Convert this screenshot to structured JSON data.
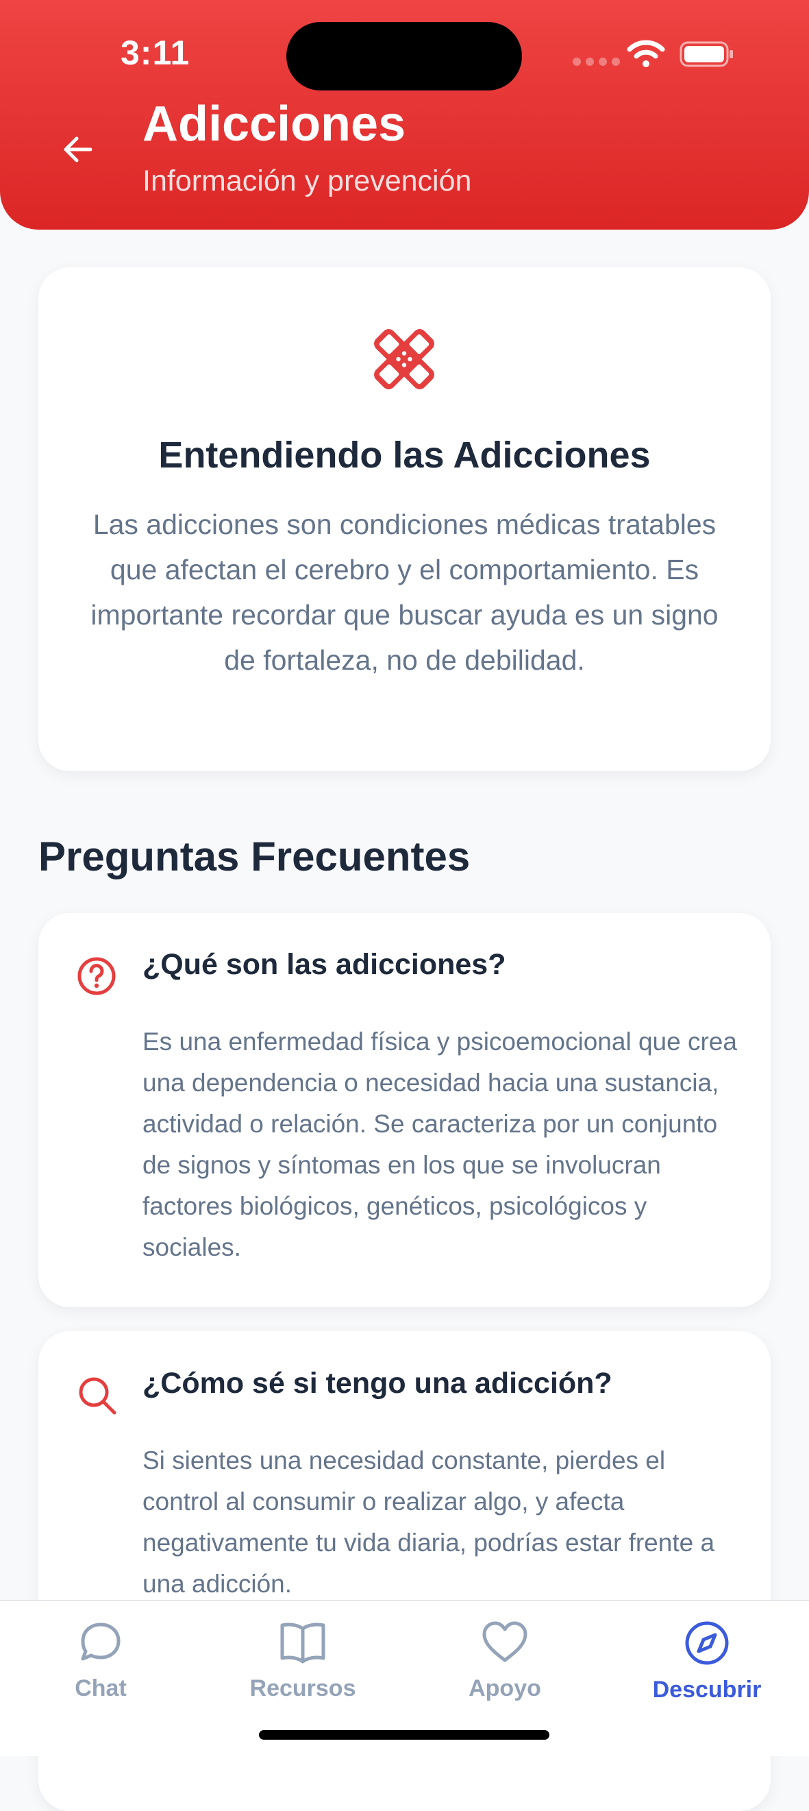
{
  "status_bar": {
    "time": "3:11"
  },
  "header": {
    "title": "Adicciones",
    "subtitle": "Información y prevención"
  },
  "intro": {
    "icon": "bandage-icon",
    "title": "Entendiendo las Adicciones",
    "text": "Las adicciones son condiciones médicas tratables que afectan el cerebro y el comportamiento. Es importante recordar que buscar ayuda es un signo de fortaleza, no de debilidad."
  },
  "faq": {
    "section_title": "Preguntas Frecuentes",
    "items": [
      {
        "icon": "question-circle-icon",
        "question": "¿Qué son las adicciones?",
        "answer": "Es una enfermedad física y psicoemocional que crea una dependencia o necesidad hacia una sustancia, actividad o relación. Se caracteriza por un conjunto de signos y síntomas en los que se involucran factores biológicos, genéticos, psicológicos y sociales."
      },
      {
        "icon": "search-icon",
        "question": "¿Cómo sé si tengo una adicción?",
        "answer": "Si sientes una necesidad constante, pierdes el control al consumir o realizar algo, y afecta negativamente tu vida diaria, podrías estar frente a una adicción."
      }
    ]
  },
  "tabs": [
    {
      "label": "Chat",
      "icon": "chat-bubble-icon",
      "active": false
    },
    {
      "label": "Recursos",
      "icon": "book-icon",
      "active": false
    },
    {
      "label": "Apoyo",
      "icon": "heart-icon",
      "active": false
    },
    {
      "label": "Descubrir",
      "icon": "compass-icon",
      "active": true
    }
  ],
  "colors": {
    "brand_red": "#dc2626",
    "active_tab": "#3b5bdb",
    "inactive_tab": "#94a3b8"
  }
}
